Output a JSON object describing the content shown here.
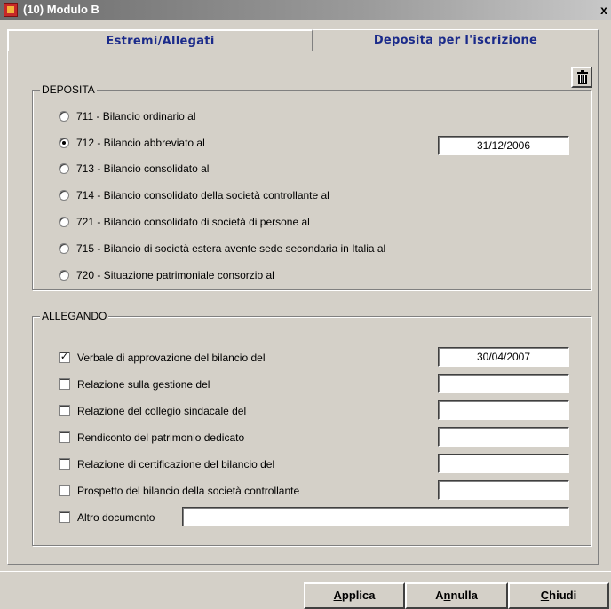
{
  "window": {
    "title": "(10) Modulo B",
    "close_label": "x"
  },
  "tabs": [
    {
      "label": "Estremi/Allegati",
      "active": true
    },
    {
      "label": "Deposita per l'iscrizione",
      "active": false
    }
  ],
  "deposita": {
    "title": "DEPOSITA",
    "options": [
      {
        "label": "711 - Bilancio ordinario al",
        "selected": false
      },
      {
        "label": "712 - Bilancio abbreviato al",
        "selected": true,
        "date": "31/12/2006"
      },
      {
        "label": "713 - Bilancio consolidato al",
        "selected": false
      },
      {
        "label": "714 - Bilancio consolidato della società controllante al",
        "selected": false
      },
      {
        "label": "721 - Bilancio consolidato di società di persone al",
        "selected": false
      },
      {
        "label": "715 - Bilancio di società estera avente sede secondaria in Italia al",
        "selected": false
      },
      {
        "label": "720 - Situazione patrimoniale consorzio al",
        "selected": false
      }
    ]
  },
  "allegando": {
    "title": "ALLEGANDO",
    "items": [
      {
        "label": "Verbale di approvazione del bilancio del",
        "checked": true,
        "value": "30/04/2007"
      },
      {
        "label": "Relazione sulla gestione del",
        "checked": false,
        "value": ""
      },
      {
        "label": "Relazione del collegio sindacale del",
        "checked": false,
        "value": ""
      },
      {
        "label": "Rendiconto del patrimonio dedicato",
        "checked": false,
        "value": ""
      },
      {
        "label": "Relazione di certificazione del bilancio del",
        "checked": false,
        "value": ""
      },
      {
        "label": "Prospetto del bilancio della società controllante",
        "checked": false,
        "value": ""
      },
      {
        "label": "Altro documento",
        "checked": false,
        "value": ""
      }
    ]
  },
  "buttons": {
    "applica": {
      "mnemonic": "A",
      "rest": "pplica"
    },
    "annulla": {
      "pre": "A",
      "mnemonic": "n",
      "rest": "nulla"
    },
    "chiudi": {
      "mnemonic": "C",
      "rest": "hiudi"
    }
  },
  "icons": {
    "trash": "trash-icon",
    "app": "app-icon"
  },
  "colors": {
    "tab_text": "#1a2a8a",
    "face": "#d4d0c8"
  }
}
